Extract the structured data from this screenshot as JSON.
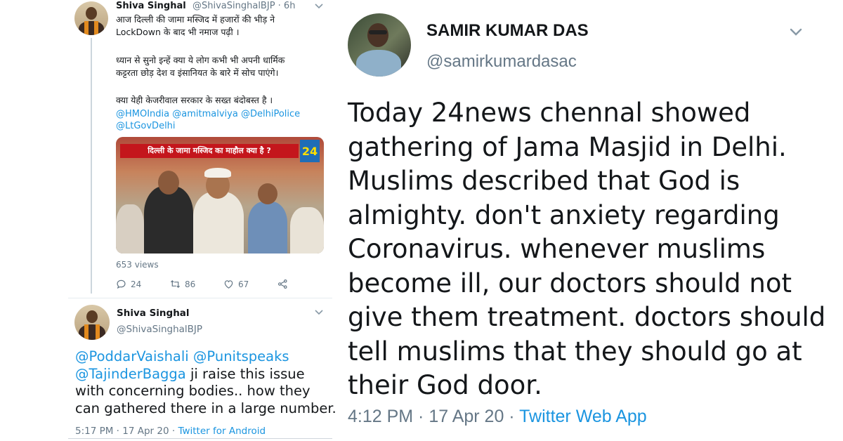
{
  "tweet1": {
    "name": "Shiva Singhal",
    "handle": "@ShivaSinghalBJP · 6h",
    "lines": [
      "आज दिल्ली की जामा मस्जिद में हजारों की भीड़ ने",
      "LockDown के बाद भी नमाज पढ़ी ।",
      "ध्यान से सुनो इन्हें क्या ये लोग कभी भी अपनी धार्मिक",
      "कट्टरता छोड़ देश व इंसानियत के बारे में सोच पाएंगे।",
      "क्या येही केजरीवाल सरकार के सख्त बंदोबस्त है ।"
    ],
    "mentions": [
      "@HMOIndia",
      "@amitmalviya",
      "@DelhiPolice",
      "@LtGovDelhi"
    ],
    "video": {
      "banner": "दिल्ली के जामा मस्जिद का माहौल क्या है ?",
      "logo": "24"
    },
    "views": "653 views",
    "replies": "24",
    "retweets": "86",
    "likes": "67"
  },
  "tweet2": {
    "name": "Shiva Singhal",
    "handle": "@ShivaSinghalBJP",
    "mentions": [
      "@PoddarVaishali",
      "@Punitspeaks",
      "@TajinderBagga"
    ],
    "text_after_mentions": "ji raise this issue",
    "lines": [
      "with concerning bodies.. how they",
      "can gathered there in a large number."
    ],
    "timestamp": "5:17 PM · 17 Apr 20 · ",
    "source": "Twitter for Android"
  },
  "tweet3": {
    "name": "SAMIR KUMAR DAS",
    "handle": "@samirkumardasac",
    "lines": [
      "Today 24news chennal showed",
      "gathering of Jama Masjid in Delhi.",
      "Muslims described that God is",
      "almighty. don't anxiety regarding",
      "Coronavirus. whenever muslims",
      "become ill, our doctors should not",
      "give them treatment. doctors should",
      "tell muslims that they should go at",
      "their God door."
    ],
    "timestamp": "4:12 PM · 17 Apr 20 · ",
    "source": "Twitter Web App"
  },
  "colors": {
    "link": "#1b95e0",
    "secondary_text": "#657786",
    "primary_text": "#14171a"
  }
}
